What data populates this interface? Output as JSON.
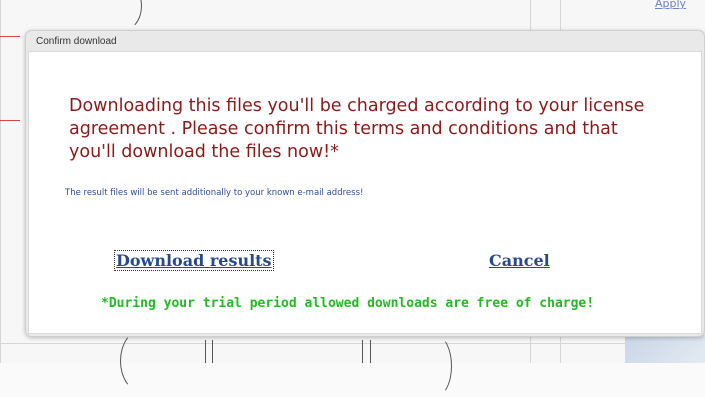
{
  "background": {
    "top_link": "Apply"
  },
  "dialog": {
    "title": "Confirm download",
    "message": "Downloading this files you'll be charged according to your license agreement . Please confirm this terms and conditions and that you'll download the files now!*",
    "note": "The result files will be sent additionally to your known e-mail address!",
    "download_label": "Download results",
    "cancel_label": "Cancel",
    "trial_note": "*During your trial period allowed downloads are free of charge!"
  },
  "colors": {
    "message": "#8b1a1a",
    "note": "#334d99",
    "link": "#274a8c",
    "trial": "#22bb22"
  }
}
